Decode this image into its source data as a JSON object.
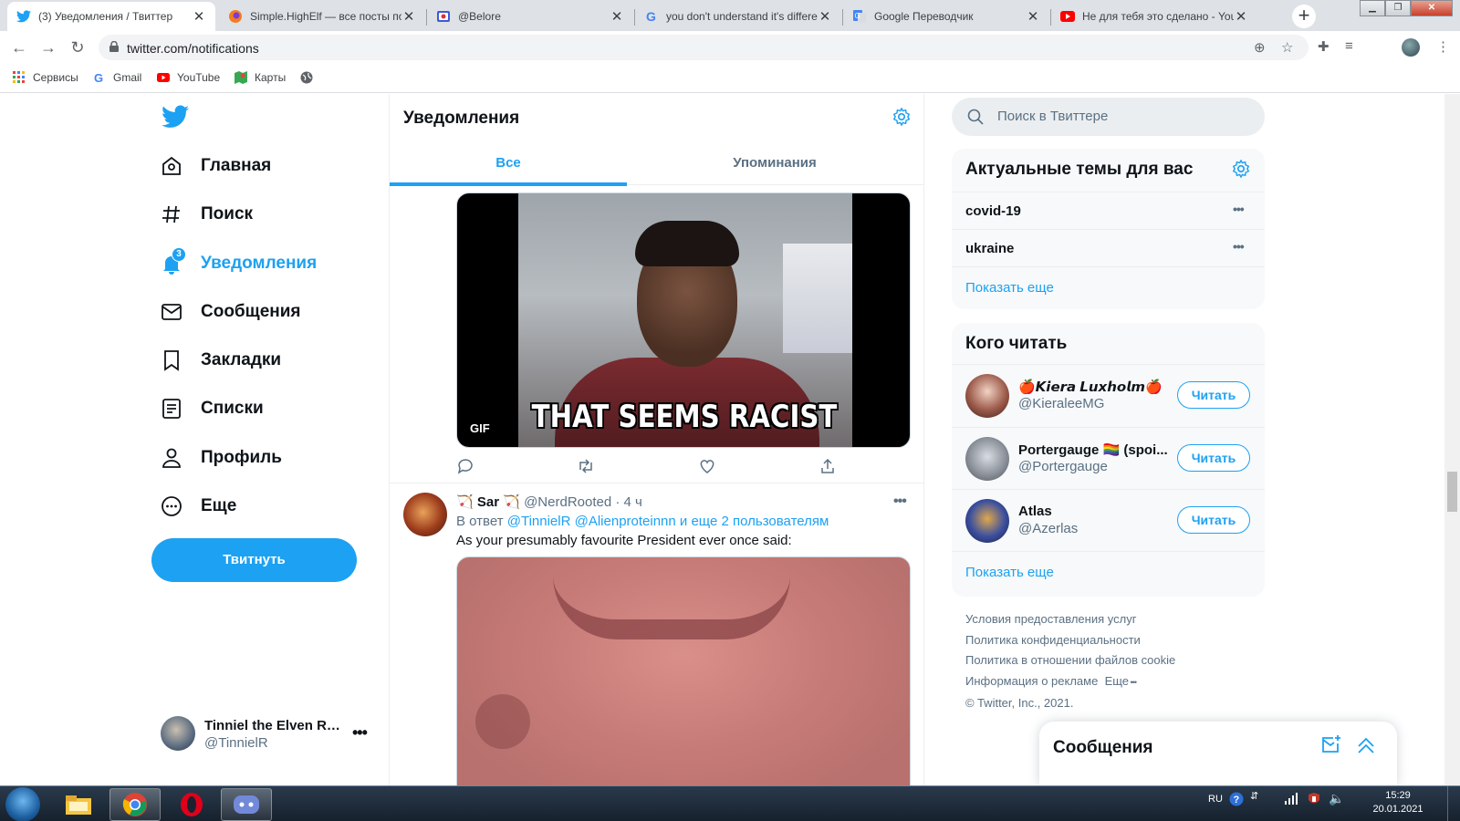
{
  "browser": {
    "tabs": [
      {
        "title": "(3) Уведомления / Твиттер",
        "icon": "twitter-icon",
        "active": true
      },
      {
        "title": "Simple.HighElf — все посты по",
        "icon": "firefox-like-icon"
      },
      {
        "title": "@Belore",
        "icon": "profile-card-icon"
      },
      {
        "title": "you don't understand it's differe",
        "icon": "google-icon"
      },
      {
        "title": "Google Переводчик",
        "icon": "google-translate-icon"
      },
      {
        "title": "Не для тебя это сделано - You",
        "icon": "youtube-icon"
      }
    ],
    "url": "twitter.com/notifications",
    "bookmarks": [
      "Сервисы",
      "Gmail",
      "YouTube",
      "Карты"
    ]
  },
  "nav": {
    "items": [
      {
        "label": "Главная",
        "icon": "home-icon"
      },
      {
        "label": "Поиск",
        "icon": "hashtag-icon"
      },
      {
        "label": "Уведомления",
        "icon": "bell-icon",
        "badge": "3",
        "active": true
      },
      {
        "label": "Сообщения",
        "icon": "envelope-icon"
      },
      {
        "label": "Закладки",
        "icon": "bookmark-icon"
      },
      {
        "label": "Списки",
        "icon": "list-icon"
      },
      {
        "label": "Профиль",
        "icon": "person-icon"
      },
      {
        "label": "Еще",
        "icon": "more-circle-icon"
      }
    ],
    "tweet_button": "Твитнуть",
    "account": {
      "name": "Tinniel the Elven Ra...",
      "handle": "@TinnielR"
    }
  },
  "main": {
    "title": "Уведомления",
    "tabs": [
      "Все",
      "Упоминания"
    ],
    "gif1": {
      "caption": "THAT SEEMS RACIST",
      "label": "GIF"
    },
    "tweet2": {
      "name": "Sar",
      "handle": "@NerdRooted",
      "time": "· 4 ч",
      "reply_prefix": "В ответ",
      "reply_mentions": "@TinnielR @Alienproteinnn",
      "reply_suffix": "и еще 2 пользователям",
      "text": "As your presumably favourite President ever once said:"
    }
  },
  "sidebar": {
    "search_placeholder": "Поиск в Твиттере",
    "trends": {
      "title": "Актуальные темы для вас",
      "items": [
        "covid-19",
        "ukraine"
      ],
      "show_more": "Показать еще"
    },
    "who_to_follow": {
      "title": "Кого читать",
      "items": [
        {
          "name": "🍎𝙆𝙞𝙚𝙧𝙖 𝙇𝙪𝙭𝙝𝙤𝙡𝙢🍎",
          "handle": "@KieraleeMG",
          "button": "Читать"
        },
        {
          "name": "Portergauge 🏳️‍🌈 (spoi...",
          "handle": "@Portergauge",
          "button": "Читать"
        },
        {
          "name": "Atlas",
          "handle": "@Azerlas",
          "button": "Читать"
        }
      ],
      "show_more": "Показать еще"
    },
    "footer": [
      "Условия предоставления услуг",
      "Политика конфиденциальности",
      "Политика в отношении файлов cookie",
      "Информация о рекламе",
      "Еще",
      "© Twitter, Inc., 2021."
    ]
  },
  "messages_drawer": {
    "title": "Сообщения"
  },
  "taskbar": {
    "lang": "RU",
    "time": "15:29",
    "date": "20.01.2021"
  },
  "colors": {
    "accent": "#1da1f2",
    "text": "#0f1419",
    "secondary": "#5b7083"
  }
}
